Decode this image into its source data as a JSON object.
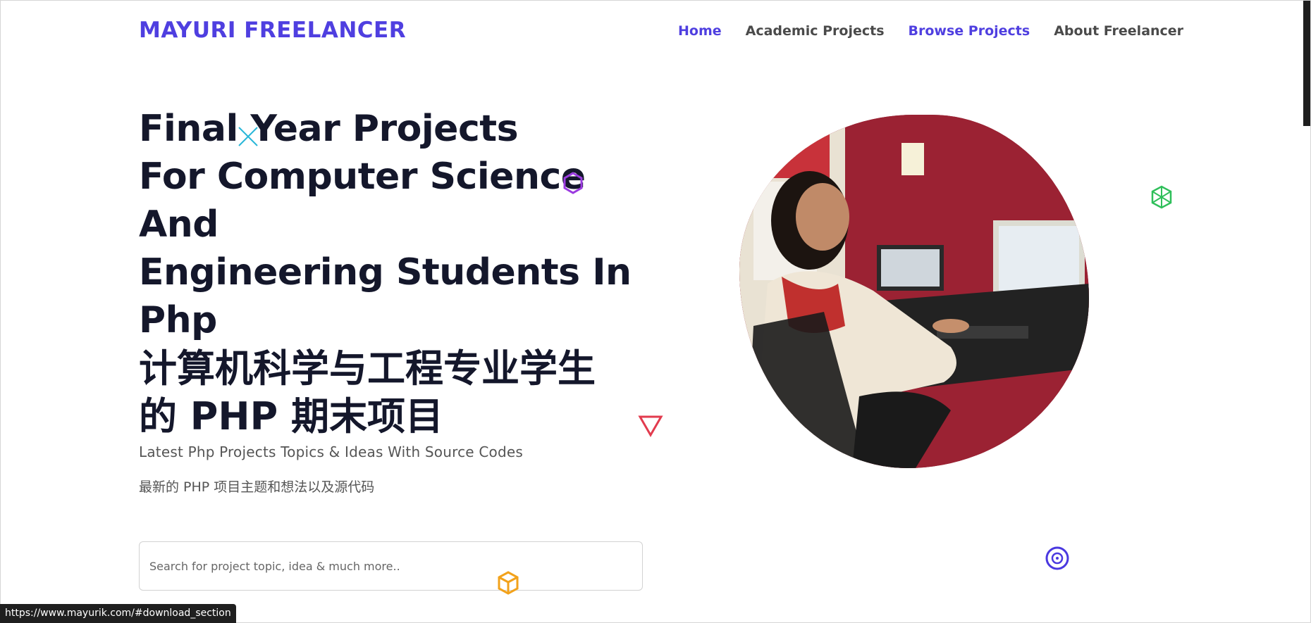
{
  "header": {
    "brand": "MAYURI FREELANCER",
    "nav": [
      {
        "label": "Home",
        "active": true
      },
      {
        "label": "Academic Projects",
        "active": false
      },
      {
        "label": "Browse Projects",
        "active": true
      },
      {
        "label": "About Freelancer",
        "active": false
      }
    ]
  },
  "hero": {
    "title_lines": [
      "Final Year Projects",
      "For Computer Science And",
      "Engineering Students In",
      "Php"
    ],
    "title_zh_lines": [
      "计算机科学与工程专业学生",
      "的 PHP 期末项目"
    ],
    "subtitle_en": "Latest Php Projects Topics & Ideas With Source Codes",
    "subtitle_zh": "最新的 PHP 项目主题和想法以及源代码",
    "search": {
      "placeholder": "Search for project topic, idea & much more..",
      "value": ""
    }
  },
  "status_bar": {
    "url": "https://www.mayurik.com/#download_section"
  },
  "colors": {
    "brand": "#4f3fe0",
    "text": "#14172b",
    "muted": "#555555"
  },
  "icons": [
    "x-cross-icon",
    "hexagon-outline-icon",
    "triangle-outline-icon",
    "cube-outline-icon",
    "box-outline-icon",
    "disc-icon"
  ]
}
